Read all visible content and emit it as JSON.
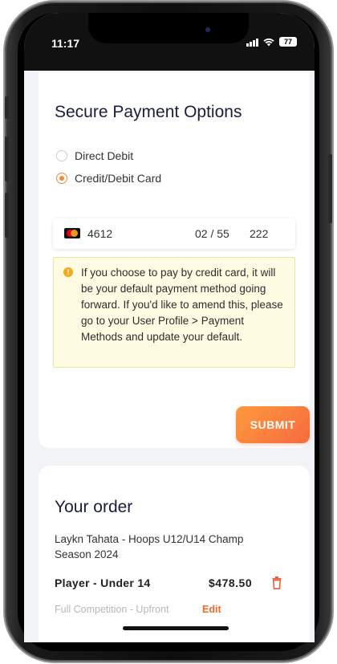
{
  "status_bar": {
    "time": "11:17",
    "battery": "77"
  },
  "payment": {
    "title": "Secure Payment Options",
    "options": [
      {
        "label": "Direct Debit",
        "selected": false
      },
      {
        "label": "Credit/Debit Card",
        "selected": true
      }
    ],
    "card": {
      "icon": "mastercard-icon",
      "number": "4612",
      "expiry": "02 / 55",
      "cvc": "222"
    },
    "notice": {
      "icon": "info-icon",
      "text": "If you choose to pay by credit card, it will be your default payment method going forward. If you'd like to amend this, please go to your User Profile > Payment Methods and update your default."
    },
    "submit_label": "SUBMIT"
  },
  "order": {
    "title": "Your order",
    "description": "Laykn Tahata - Hoops U12/U14 Champ Season 2024",
    "item": {
      "name": "Player - Under 14",
      "price": "$478.50",
      "subtitle": "Full Competition - Upfront",
      "edit_label": "Edit"
    }
  },
  "colors": {
    "accent": "#f56a3f",
    "accent_light": "#ff9a3c",
    "title": "#1a1d3b",
    "notice_bg": "#fefbe3"
  }
}
